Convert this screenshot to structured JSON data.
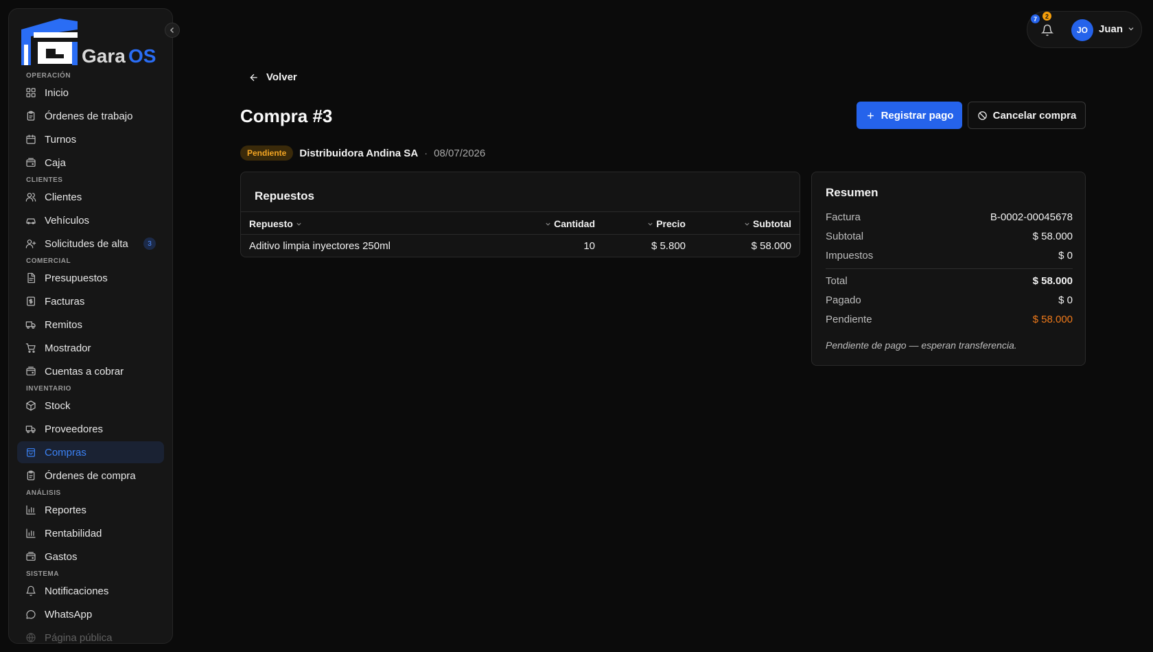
{
  "app": {
    "brand": "GaraOS",
    "colors": {
      "accent": "#2563eb",
      "pending": "#f5a623",
      "pending_amount": "#f07a1a",
      "background": "#0b0b0b"
    }
  },
  "sidebar": {
    "collapse_icon": "chevron-left-icon",
    "sections": [
      {
        "title": "OPERACIÓN",
        "items": [
          {
            "label": "Inicio",
            "icon": "grid-icon"
          },
          {
            "label": "Órdenes de trabajo",
            "icon": "clipboard-icon"
          },
          {
            "label": "Turnos",
            "icon": "calendar-icon"
          },
          {
            "label": "Caja",
            "icon": "wallet-icon"
          }
        ]
      },
      {
        "title": "CLIENTES",
        "items": [
          {
            "label": "Clientes",
            "icon": "users-icon"
          },
          {
            "label": "Vehículos",
            "icon": "car-icon"
          },
          {
            "label": "Solicitudes de alta",
            "icon": "user-plus-icon",
            "badge": "3"
          }
        ]
      },
      {
        "title": "COMERCIAL",
        "items": [
          {
            "label": "Presupuestos",
            "icon": "document-icon"
          },
          {
            "label": "Facturas",
            "icon": "invoice-icon"
          },
          {
            "label": "Remitos",
            "icon": "truck-icon"
          },
          {
            "label": "Mostrador",
            "icon": "cart-icon"
          },
          {
            "label": "Cuentas a cobrar",
            "icon": "wallet-icon"
          }
        ]
      },
      {
        "title": "INVENTARIO",
        "items": [
          {
            "label": "Stock",
            "icon": "box-icon"
          },
          {
            "label": "Proveedores",
            "icon": "truck-icon"
          },
          {
            "label": "Compras",
            "icon": "shopping-bag-icon",
            "active": true
          },
          {
            "label": "Órdenes de compra",
            "icon": "clipboard-icon"
          }
        ]
      },
      {
        "title": "ANÁLISIS",
        "items": [
          {
            "label": "Reportes",
            "icon": "bar-chart-icon"
          },
          {
            "label": "Rentabilidad",
            "icon": "bar-chart-icon"
          },
          {
            "label": "Gastos",
            "icon": "wallet-icon"
          }
        ]
      },
      {
        "title": "SISTEMA",
        "items": [
          {
            "label": "Notificaciones",
            "icon": "bell-icon"
          },
          {
            "label": "WhatsApp",
            "icon": "chat-icon"
          },
          {
            "label": "Página pública",
            "icon": "globe-icon",
            "faded": true
          }
        ]
      }
    ]
  },
  "topbar": {
    "notifications_badge_blue": "7",
    "notifications_badge_orange": "2",
    "user_initials": "JO",
    "user_name": "Juan"
  },
  "main": {
    "back_label": "Volver",
    "title": "Compra #3",
    "actions": {
      "register_payment": "Registrar pago",
      "cancel_purchase": "Cancelar compra"
    },
    "status": "Pendiente",
    "supplier": "Distribuidora Andina SA",
    "separator": "·",
    "date": "08/07/2026",
    "parts": {
      "title": "Repuestos",
      "columns": {
        "part": "Repuesto",
        "quantity": "Cantidad",
        "price": "Precio",
        "subtotal": "Subtotal"
      },
      "rows": [
        {
          "part": "Aditivo limpia inyectores 250ml",
          "quantity": "10",
          "price": "$ 5.800",
          "subtotal": "$ 58.000"
        }
      ]
    },
    "summary": {
      "title": "Resumen",
      "invoice_label": "Factura",
      "invoice_value": "B-0002-00045678",
      "subtotal_label": "Subtotal",
      "subtotal_value": "$ 58.000",
      "taxes_label": "Impuestos",
      "taxes_value": "$ 0",
      "total_label": "Total",
      "total_value": "$ 58.000",
      "paid_label": "Pagado",
      "paid_value": "$ 0",
      "pending_label": "Pendiente",
      "pending_value": "$ 58.000",
      "note": "Pendiente de pago — esperan transferencia."
    }
  }
}
